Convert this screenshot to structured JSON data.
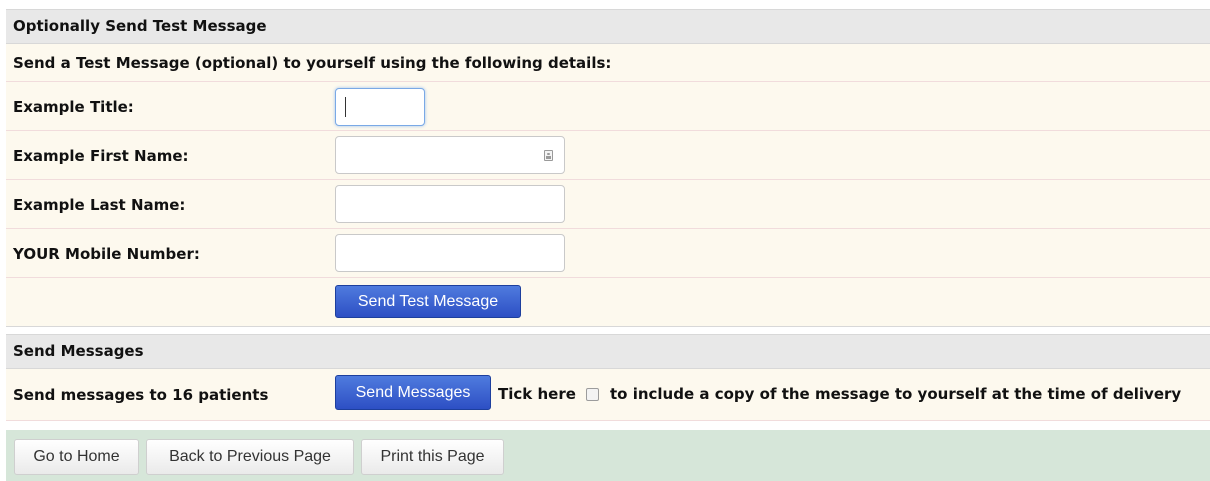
{
  "test_section": {
    "heading": "Optionally Send Test Message",
    "instructions": "Send a Test Message (optional) to yourself using the following details:",
    "fields": {
      "title_label": "Example Title:",
      "first_name_label": "Example First Name:",
      "last_name_label": "Example Last Name:",
      "mobile_label": "YOUR Mobile Number:"
    },
    "send_test_button": "Send Test Message"
  },
  "send_section": {
    "heading": "Send Messages",
    "label": "Send messages to 16 patients",
    "send_button": "Send Messages",
    "tick_prefix": "Tick here",
    "tick_suffix": "to include a copy of the message to yourself at the time of delivery",
    "copy_checked": false
  },
  "footer": {
    "home_button": "Go to Home",
    "back_button": "Back to Previous Page",
    "print_button": "Print this Page"
  },
  "colors": {
    "accent_blue": "#2d4fc4",
    "row_background": "#fdf9ee",
    "header_background": "#e8e8e8",
    "footer_background": "#d6e6d9"
  },
  "icons": {
    "contact_card": "contact-card-icon"
  }
}
